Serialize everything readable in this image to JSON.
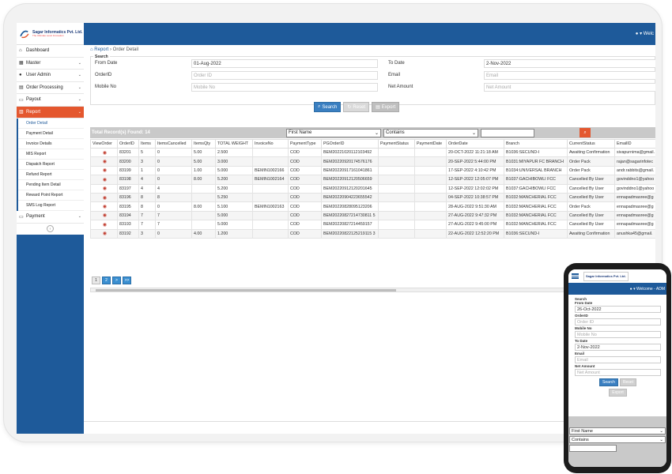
{
  "brand": {
    "name": "Sagar Informatics Pvt. Ltd.",
    "tagline": "The Ultimate Level Innovation"
  },
  "user": {
    "label": "Welc"
  },
  "sidebar": {
    "items": [
      {
        "icon": "home-icon",
        "label": "Dashboard"
      },
      {
        "icon": "table-icon",
        "label": "Master"
      },
      {
        "icon": "user-icon",
        "label": "User Admin"
      },
      {
        "icon": "document-icon",
        "label": "Order Processing"
      },
      {
        "icon": "card-icon",
        "label": "Payout"
      },
      {
        "icon": "chart-icon",
        "label": "Report"
      },
      {
        "icon": "payment-icon",
        "label": "Payment"
      }
    ],
    "report_sub": [
      "Order Detail",
      "Payment Detail",
      "Invoice Details",
      "MIS Report",
      "Dispatch Report",
      "Refund Report",
      "Pending Item Detail",
      "Reward Point Report",
      "SMS Log Report"
    ],
    "collapse": "‹"
  },
  "breadcrumb": {
    "root": "Report",
    "current": "Order Detail"
  },
  "search": {
    "legend": "Search",
    "from_date_label": "From Date",
    "from_date": "01-Aug-2022",
    "to_date_label": "To Date",
    "to_date": "2-Nov-2022",
    "orderid_label": "OrderID",
    "orderid_ph": "Order ID",
    "email_label": "Email",
    "email_ph": "Email",
    "mobile_label": "Mobile No",
    "mobile_ph": "Mobile No",
    "net_label": "Net Amount",
    "net_ph": "Net Amount",
    "btn_search": "Search",
    "btn_reset": "Reset",
    "btn_export": "Export"
  },
  "results": {
    "count_text": "Total Record(s) Found: 14",
    "filter_field": "First Name",
    "filter_op": "Contains"
  },
  "table": {
    "headers": [
      "ViewOrder",
      "OrderID",
      "Items",
      "ItemsCancelled",
      "ItemsQty",
      "TOTAL WEIGHT",
      "InvoiceNo",
      "PaymentType",
      "PGOrderID",
      "PaymentStatus",
      "PaymentDate",
      "OrderDate",
      "Branch",
      "CurrentStatus",
      "EmailID"
    ],
    "rows": [
      [
        "",
        "83201",
        "5",
        "0",
        "5.00",
        "2.500",
        "",
        "COD",
        "BEM20221020112103492",
        "",
        "",
        "20-OCT-2022 11:21:18 AM",
        "B1036:SECUND-I",
        "Awaiting Confirmation",
        "sivapurnima@gmail."
      ],
      [
        "",
        "83200",
        "3",
        "0",
        "5.00",
        "3.000",
        "",
        "COD",
        "BEM20220920174576176",
        "",
        "",
        "20-SEP-2022 5:44:00 PM",
        "B1031:MIYAPUR FC BRANCH",
        "Order Pack",
        "rajan@sagarinfotec"
      ],
      [
        "",
        "83199",
        "1",
        "0",
        "1.00",
        "5.000",
        "BEMIN1002166",
        "COD",
        "BEM20220917161041861",
        "",
        "",
        "17-SEP-2022 4:10:42 PM",
        "B1034:UNIVERSAL BRANCH",
        "Order Pack",
        "andr.rabbits@gmail."
      ],
      [
        "",
        "83198",
        "4",
        "0",
        "8.00",
        "5.200",
        "BEMIN1002164",
        "COD",
        "BEM20220912120506659",
        "",
        "",
        "12-SEP-2022 12:05:07 PM",
        "B1037:GACHIBOWLI FCC",
        "Cancelled By User",
        "govinddno1@yahoo"
      ],
      [
        "",
        "83197",
        "4",
        "4",
        "",
        "5.200",
        "",
        "COD",
        "BEM20220912120201645",
        "",
        "",
        "12-SEP-2022 12:02:02 PM",
        "B1037:GACHIBOWLI FCC",
        "Cancelled By User",
        "govinddno1@yahoo"
      ],
      [
        "",
        "83196",
        "8",
        "8",
        "",
        "5.250",
        "",
        "COD",
        "BEM20220904223655542",
        "",
        "",
        "04-SEP-2022 10:38:57 PM",
        "B1032:MANCHERIAL FCC",
        "Cancelled By User",
        "ennapadmasree@g"
      ],
      [
        "",
        "83195",
        "8",
        "0",
        "8.00",
        "5.100",
        "BEMIN1002163",
        "COD",
        "BEM20220828095123206",
        "",
        "",
        "28-AUG-2022 9:51:30 AM",
        "B1032:MANCHERIAL FCC",
        "Order Pack",
        "ennapadmasree@g"
      ],
      [
        "",
        "83194",
        "7",
        "7",
        "",
        "5.000",
        "",
        "COD",
        "BEM20220827214730811 5",
        "",
        "",
        "27-AUG-2022 9:47:32 PM",
        "B1032:MANCHERIAL FCC",
        "Cancelled By User",
        "ennapadmasree@g"
      ],
      [
        "",
        "83193",
        "7",
        "7",
        "",
        "5.000",
        "",
        "COD",
        "BEM20220827214459157",
        "",
        "",
        "27-AUG-2022 9:45:00 PM",
        "B1032:MANCHERIAL FCC",
        "Cancelled By User",
        "ennapadmasree@g"
      ],
      [
        "",
        "83192",
        "3",
        "0",
        "4.00",
        "1.200",
        "",
        "COD",
        "BEM20220822125219115 3",
        "",
        "",
        "22-AUG-2022 12:52:20 PM",
        "B1036:SECUND-I",
        "Awaiting Confirmation",
        "anushka45@gmail."
      ]
    ]
  },
  "pager": [
    "1",
    "2",
    ">",
    ">>"
  ],
  "phone": {
    "welcome": "Welcome - ADM",
    "legend": "Search",
    "from_label": "From Date",
    "from_val": "26-Oct-2022",
    "orderid_label": "OrderID",
    "orderid_ph": "Order ID",
    "mobile_label": "Mobile No",
    "mobile_ph": "Mobile No",
    "to_label": "To Date",
    "to_val": "2-Nov-2022",
    "email_label": "Email",
    "email_ph": "Email",
    "net_label": "Net Amount",
    "net_ph": "Net Amount",
    "btn_search": "Search",
    "btn_reset": "Reset",
    "btn_export": "Export",
    "filter_field": "First Name",
    "filter_op": "Contains"
  },
  "colors": {
    "primary": "#1e5a9a",
    "accent": "#e4572e",
    "button": "#3a7fc1"
  }
}
